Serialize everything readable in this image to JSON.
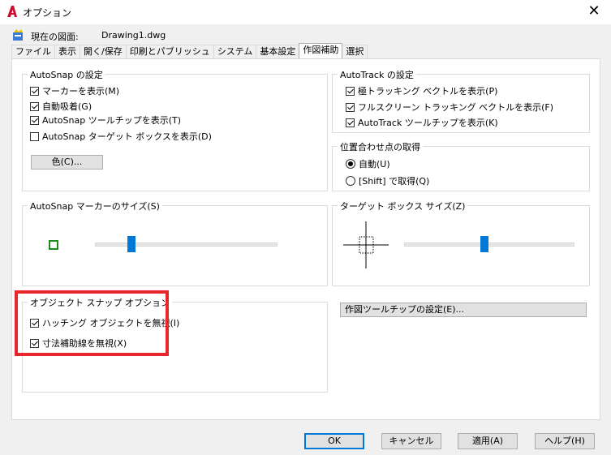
{
  "window": {
    "title": "オプション",
    "close_symbol": "✕"
  },
  "current_drawing": {
    "label": "現在の図面:",
    "value": "Drawing1.dwg"
  },
  "tabs": [
    {
      "label": "ファイル"
    },
    {
      "label": "表示"
    },
    {
      "label": "開く/保存"
    },
    {
      "label": "印刷とパブリッシュ"
    },
    {
      "label": "システム"
    },
    {
      "label": "基本設定"
    },
    {
      "label": "作図補助",
      "active": true
    },
    {
      "label": "選択"
    }
  ],
  "autosnap": {
    "title": "AutoSnap の設定",
    "options": [
      {
        "label": "マーカーを表示(M)",
        "checked": true
      },
      {
        "label": "自動吸着(G)",
        "checked": true
      },
      {
        "label": "AutoSnap ツールチップを表示(T)",
        "checked": true
      },
      {
        "label": "AutoSnap ターゲット ボックスを表示(D)",
        "checked": false
      }
    ],
    "color_button": "色(C)..."
  },
  "autotrack": {
    "title": "AutoTrack の設定",
    "options": [
      {
        "label": "極トラッキング ベクトルを表示(P)",
        "checked": true
      },
      {
        "label": "フルスクリーン トラッキング ベクトルを表示(F)",
        "checked": true
      },
      {
        "label": "AutoTrack ツールチップを表示(K)",
        "checked": true
      }
    ]
  },
  "alignment": {
    "title": "位置合わせ点の取得",
    "options": [
      {
        "label": "自動(U)",
        "selected": true
      },
      {
        "label": "[Shift] で取得(Q)",
        "selected": false
      }
    ]
  },
  "marker_size": {
    "title": "AutoSnap マーカーのサイズ(S)",
    "level": 0.2,
    "marker_color": "#1a8c1a"
  },
  "target_size": {
    "title": "ターゲット ボックス サイズ(Z)",
    "level": 0.47
  },
  "object_snap": {
    "title": "オブジェクト スナップ オプション",
    "options": [
      {
        "label": "ハッチング オブジェクトを無視(I)",
        "checked": true
      },
      {
        "label": "寸法補助線を無視(X)",
        "checked": true
      }
    ]
  },
  "tooltip_button": "作図ツールチップの設定(E)...",
  "footer": {
    "ok": "OK",
    "cancel": "キャンセル",
    "apply": "適用(A)",
    "help": "ヘルプ(H)"
  },
  "colors": {
    "accent": "#0078d7",
    "highlight": "#e8262b"
  }
}
